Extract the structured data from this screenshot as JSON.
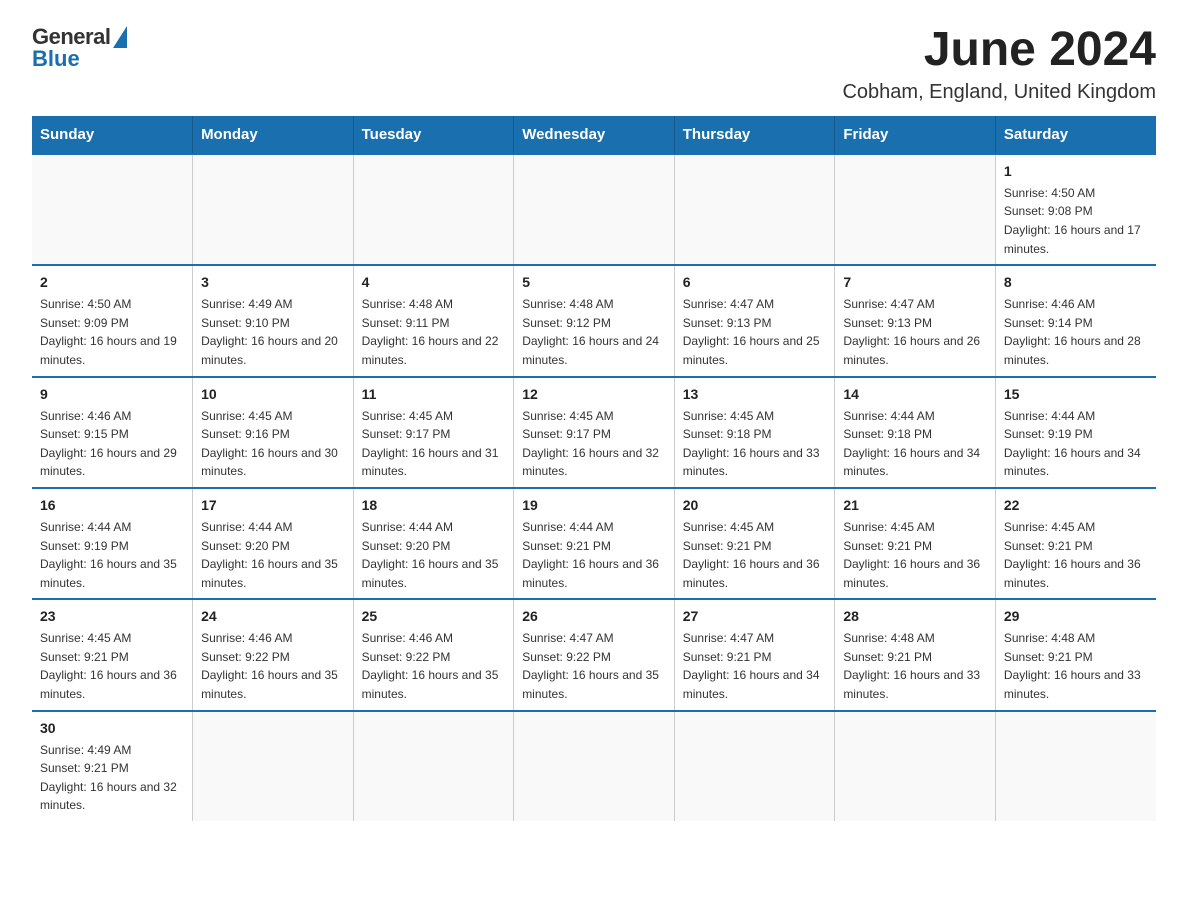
{
  "logo": {
    "general": "General",
    "blue": "Blue"
  },
  "header": {
    "month_title": "June 2024",
    "location": "Cobham, England, United Kingdom"
  },
  "days_of_week": [
    "Sunday",
    "Monday",
    "Tuesday",
    "Wednesday",
    "Thursday",
    "Friday",
    "Saturday"
  ],
  "weeks": [
    [
      {
        "day": "",
        "sunrise": "",
        "sunset": "",
        "daylight": ""
      },
      {
        "day": "",
        "sunrise": "",
        "sunset": "",
        "daylight": ""
      },
      {
        "day": "",
        "sunrise": "",
        "sunset": "",
        "daylight": ""
      },
      {
        "day": "",
        "sunrise": "",
        "sunset": "",
        "daylight": ""
      },
      {
        "day": "",
        "sunrise": "",
        "sunset": "",
        "daylight": ""
      },
      {
        "day": "",
        "sunrise": "",
        "sunset": "",
        "daylight": ""
      },
      {
        "day": "1",
        "sunrise": "Sunrise: 4:50 AM",
        "sunset": "Sunset: 9:08 PM",
        "daylight": "Daylight: 16 hours and 17 minutes."
      }
    ],
    [
      {
        "day": "2",
        "sunrise": "Sunrise: 4:50 AM",
        "sunset": "Sunset: 9:09 PM",
        "daylight": "Daylight: 16 hours and 19 minutes."
      },
      {
        "day": "3",
        "sunrise": "Sunrise: 4:49 AM",
        "sunset": "Sunset: 9:10 PM",
        "daylight": "Daylight: 16 hours and 20 minutes."
      },
      {
        "day": "4",
        "sunrise": "Sunrise: 4:48 AM",
        "sunset": "Sunset: 9:11 PM",
        "daylight": "Daylight: 16 hours and 22 minutes."
      },
      {
        "day": "5",
        "sunrise": "Sunrise: 4:48 AM",
        "sunset": "Sunset: 9:12 PM",
        "daylight": "Daylight: 16 hours and 24 minutes."
      },
      {
        "day": "6",
        "sunrise": "Sunrise: 4:47 AM",
        "sunset": "Sunset: 9:13 PM",
        "daylight": "Daylight: 16 hours and 25 minutes."
      },
      {
        "day": "7",
        "sunrise": "Sunrise: 4:47 AM",
        "sunset": "Sunset: 9:13 PM",
        "daylight": "Daylight: 16 hours and 26 minutes."
      },
      {
        "day": "8",
        "sunrise": "Sunrise: 4:46 AM",
        "sunset": "Sunset: 9:14 PM",
        "daylight": "Daylight: 16 hours and 28 minutes."
      }
    ],
    [
      {
        "day": "9",
        "sunrise": "Sunrise: 4:46 AM",
        "sunset": "Sunset: 9:15 PM",
        "daylight": "Daylight: 16 hours and 29 minutes."
      },
      {
        "day": "10",
        "sunrise": "Sunrise: 4:45 AM",
        "sunset": "Sunset: 9:16 PM",
        "daylight": "Daylight: 16 hours and 30 minutes."
      },
      {
        "day": "11",
        "sunrise": "Sunrise: 4:45 AM",
        "sunset": "Sunset: 9:17 PM",
        "daylight": "Daylight: 16 hours and 31 minutes."
      },
      {
        "day": "12",
        "sunrise": "Sunrise: 4:45 AM",
        "sunset": "Sunset: 9:17 PM",
        "daylight": "Daylight: 16 hours and 32 minutes."
      },
      {
        "day": "13",
        "sunrise": "Sunrise: 4:45 AM",
        "sunset": "Sunset: 9:18 PM",
        "daylight": "Daylight: 16 hours and 33 minutes."
      },
      {
        "day": "14",
        "sunrise": "Sunrise: 4:44 AM",
        "sunset": "Sunset: 9:18 PM",
        "daylight": "Daylight: 16 hours and 34 minutes."
      },
      {
        "day": "15",
        "sunrise": "Sunrise: 4:44 AM",
        "sunset": "Sunset: 9:19 PM",
        "daylight": "Daylight: 16 hours and 34 minutes."
      }
    ],
    [
      {
        "day": "16",
        "sunrise": "Sunrise: 4:44 AM",
        "sunset": "Sunset: 9:19 PM",
        "daylight": "Daylight: 16 hours and 35 minutes."
      },
      {
        "day": "17",
        "sunrise": "Sunrise: 4:44 AM",
        "sunset": "Sunset: 9:20 PM",
        "daylight": "Daylight: 16 hours and 35 minutes."
      },
      {
        "day": "18",
        "sunrise": "Sunrise: 4:44 AM",
        "sunset": "Sunset: 9:20 PM",
        "daylight": "Daylight: 16 hours and 35 minutes."
      },
      {
        "day": "19",
        "sunrise": "Sunrise: 4:44 AM",
        "sunset": "Sunset: 9:21 PM",
        "daylight": "Daylight: 16 hours and 36 minutes."
      },
      {
        "day": "20",
        "sunrise": "Sunrise: 4:45 AM",
        "sunset": "Sunset: 9:21 PM",
        "daylight": "Daylight: 16 hours and 36 minutes."
      },
      {
        "day": "21",
        "sunrise": "Sunrise: 4:45 AM",
        "sunset": "Sunset: 9:21 PM",
        "daylight": "Daylight: 16 hours and 36 minutes."
      },
      {
        "day": "22",
        "sunrise": "Sunrise: 4:45 AM",
        "sunset": "Sunset: 9:21 PM",
        "daylight": "Daylight: 16 hours and 36 minutes."
      }
    ],
    [
      {
        "day": "23",
        "sunrise": "Sunrise: 4:45 AM",
        "sunset": "Sunset: 9:21 PM",
        "daylight": "Daylight: 16 hours and 36 minutes."
      },
      {
        "day": "24",
        "sunrise": "Sunrise: 4:46 AM",
        "sunset": "Sunset: 9:22 PM",
        "daylight": "Daylight: 16 hours and 35 minutes."
      },
      {
        "day": "25",
        "sunrise": "Sunrise: 4:46 AM",
        "sunset": "Sunset: 9:22 PM",
        "daylight": "Daylight: 16 hours and 35 minutes."
      },
      {
        "day": "26",
        "sunrise": "Sunrise: 4:47 AM",
        "sunset": "Sunset: 9:22 PM",
        "daylight": "Daylight: 16 hours and 35 minutes."
      },
      {
        "day": "27",
        "sunrise": "Sunrise: 4:47 AM",
        "sunset": "Sunset: 9:21 PM",
        "daylight": "Daylight: 16 hours and 34 minutes."
      },
      {
        "day": "28",
        "sunrise": "Sunrise: 4:48 AM",
        "sunset": "Sunset: 9:21 PM",
        "daylight": "Daylight: 16 hours and 33 minutes."
      },
      {
        "day": "29",
        "sunrise": "Sunrise: 4:48 AM",
        "sunset": "Sunset: 9:21 PM",
        "daylight": "Daylight: 16 hours and 33 minutes."
      }
    ],
    [
      {
        "day": "30",
        "sunrise": "Sunrise: 4:49 AM",
        "sunset": "Sunset: 9:21 PM",
        "daylight": "Daylight: 16 hours and 32 minutes."
      },
      {
        "day": "",
        "sunrise": "",
        "sunset": "",
        "daylight": ""
      },
      {
        "day": "",
        "sunrise": "",
        "sunset": "",
        "daylight": ""
      },
      {
        "day": "",
        "sunrise": "",
        "sunset": "",
        "daylight": ""
      },
      {
        "day": "",
        "sunrise": "",
        "sunset": "",
        "daylight": ""
      },
      {
        "day": "",
        "sunrise": "",
        "sunset": "",
        "daylight": ""
      },
      {
        "day": "",
        "sunrise": "",
        "sunset": "",
        "daylight": ""
      }
    ]
  ],
  "colors": {
    "header_bg": "#1a6faf",
    "border": "#1a6faf"
  }
}
